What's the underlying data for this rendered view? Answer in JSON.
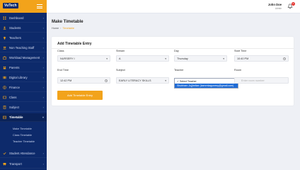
{
  "brand": {
    "logo_text": "VuTech"
  },
  "topbar": {
    "user_name": "John Doe",
    "user_role": "Admin",
    "notification_count": "0"
  },
  "sidebar": {
    "items": [
      {
        "label": "Dashboard",
        "icon": "dashboard-icon"
      },
      {
        "label": "Students",
        "icon": "students-icon"
      },
      {
        "label": "Teachers",
        "icon": "teachers-icon"
      },
      {
        "label": "Non Teaching Staff",
        "icon": "staff-icon"
      },
      {
        "label": "Workload Management",
        "icon": "workload-icon"
      },
      {
        "label": "Parents",
        "icon": "parents-icon"
      },
      {
        "label": "Digital Library",
        "icon": "library-icon"
      },
      {
        "label": "Finance",
        "icon": "finance-icon"
      },
      {
        "label": "Class",
        "icon": "class-icon"
      },
      {
        "label": "Subject",
        "icon": "subject-icon"
      },
      {
        "label": "Timetable",
        "icon": "timetable-icon"
      }
    ],
    "timetable_sub": [
      "Make Timetable",
      "Class Timetable",
      "Teacher Timetable"
    ],
    "bottom_items": [
      {
        "label": "Student Attendance",
        "icon": "attendance-icon"
      },
      {
        "label": "Transport",
        "icon": "transport-icon"
      }
    ]
  },
  "page": {
    "title": "Make Timetable",
    "breadcrumb": {
      "home": "Home",
      "current": "Timetable"
    }
  },
  "form": {
    "title": "Add Timetable Entry",
    "class_label": "Class",
    "class_value": "NURSERY I",
    "stream_label": "Stream",
    "stream_value": "A",
    "day_label": "Day",
    "day_value": "Thursday",
    "start_time_label": "Start Time",
    "start_time_value": "10:40 PM",
    "end_time_label": "End Time",
    "end_time_value": "12:42 PM",
    "subject_label": "Subject",
    "subject_value": "EARLY LITERACY SKILLS",
    "teacher_label": "Teacher",
    "teacher_options": [
      "✓ Select Teacher",
      "Shubham Jujjhelkar (kamrekagunesy@gmail.com)"
    ],
    "room_label": "Room",
    "room_placeholder": "Enter room number",
    "submit_label": "Add Timetable Entry"
  }
}
